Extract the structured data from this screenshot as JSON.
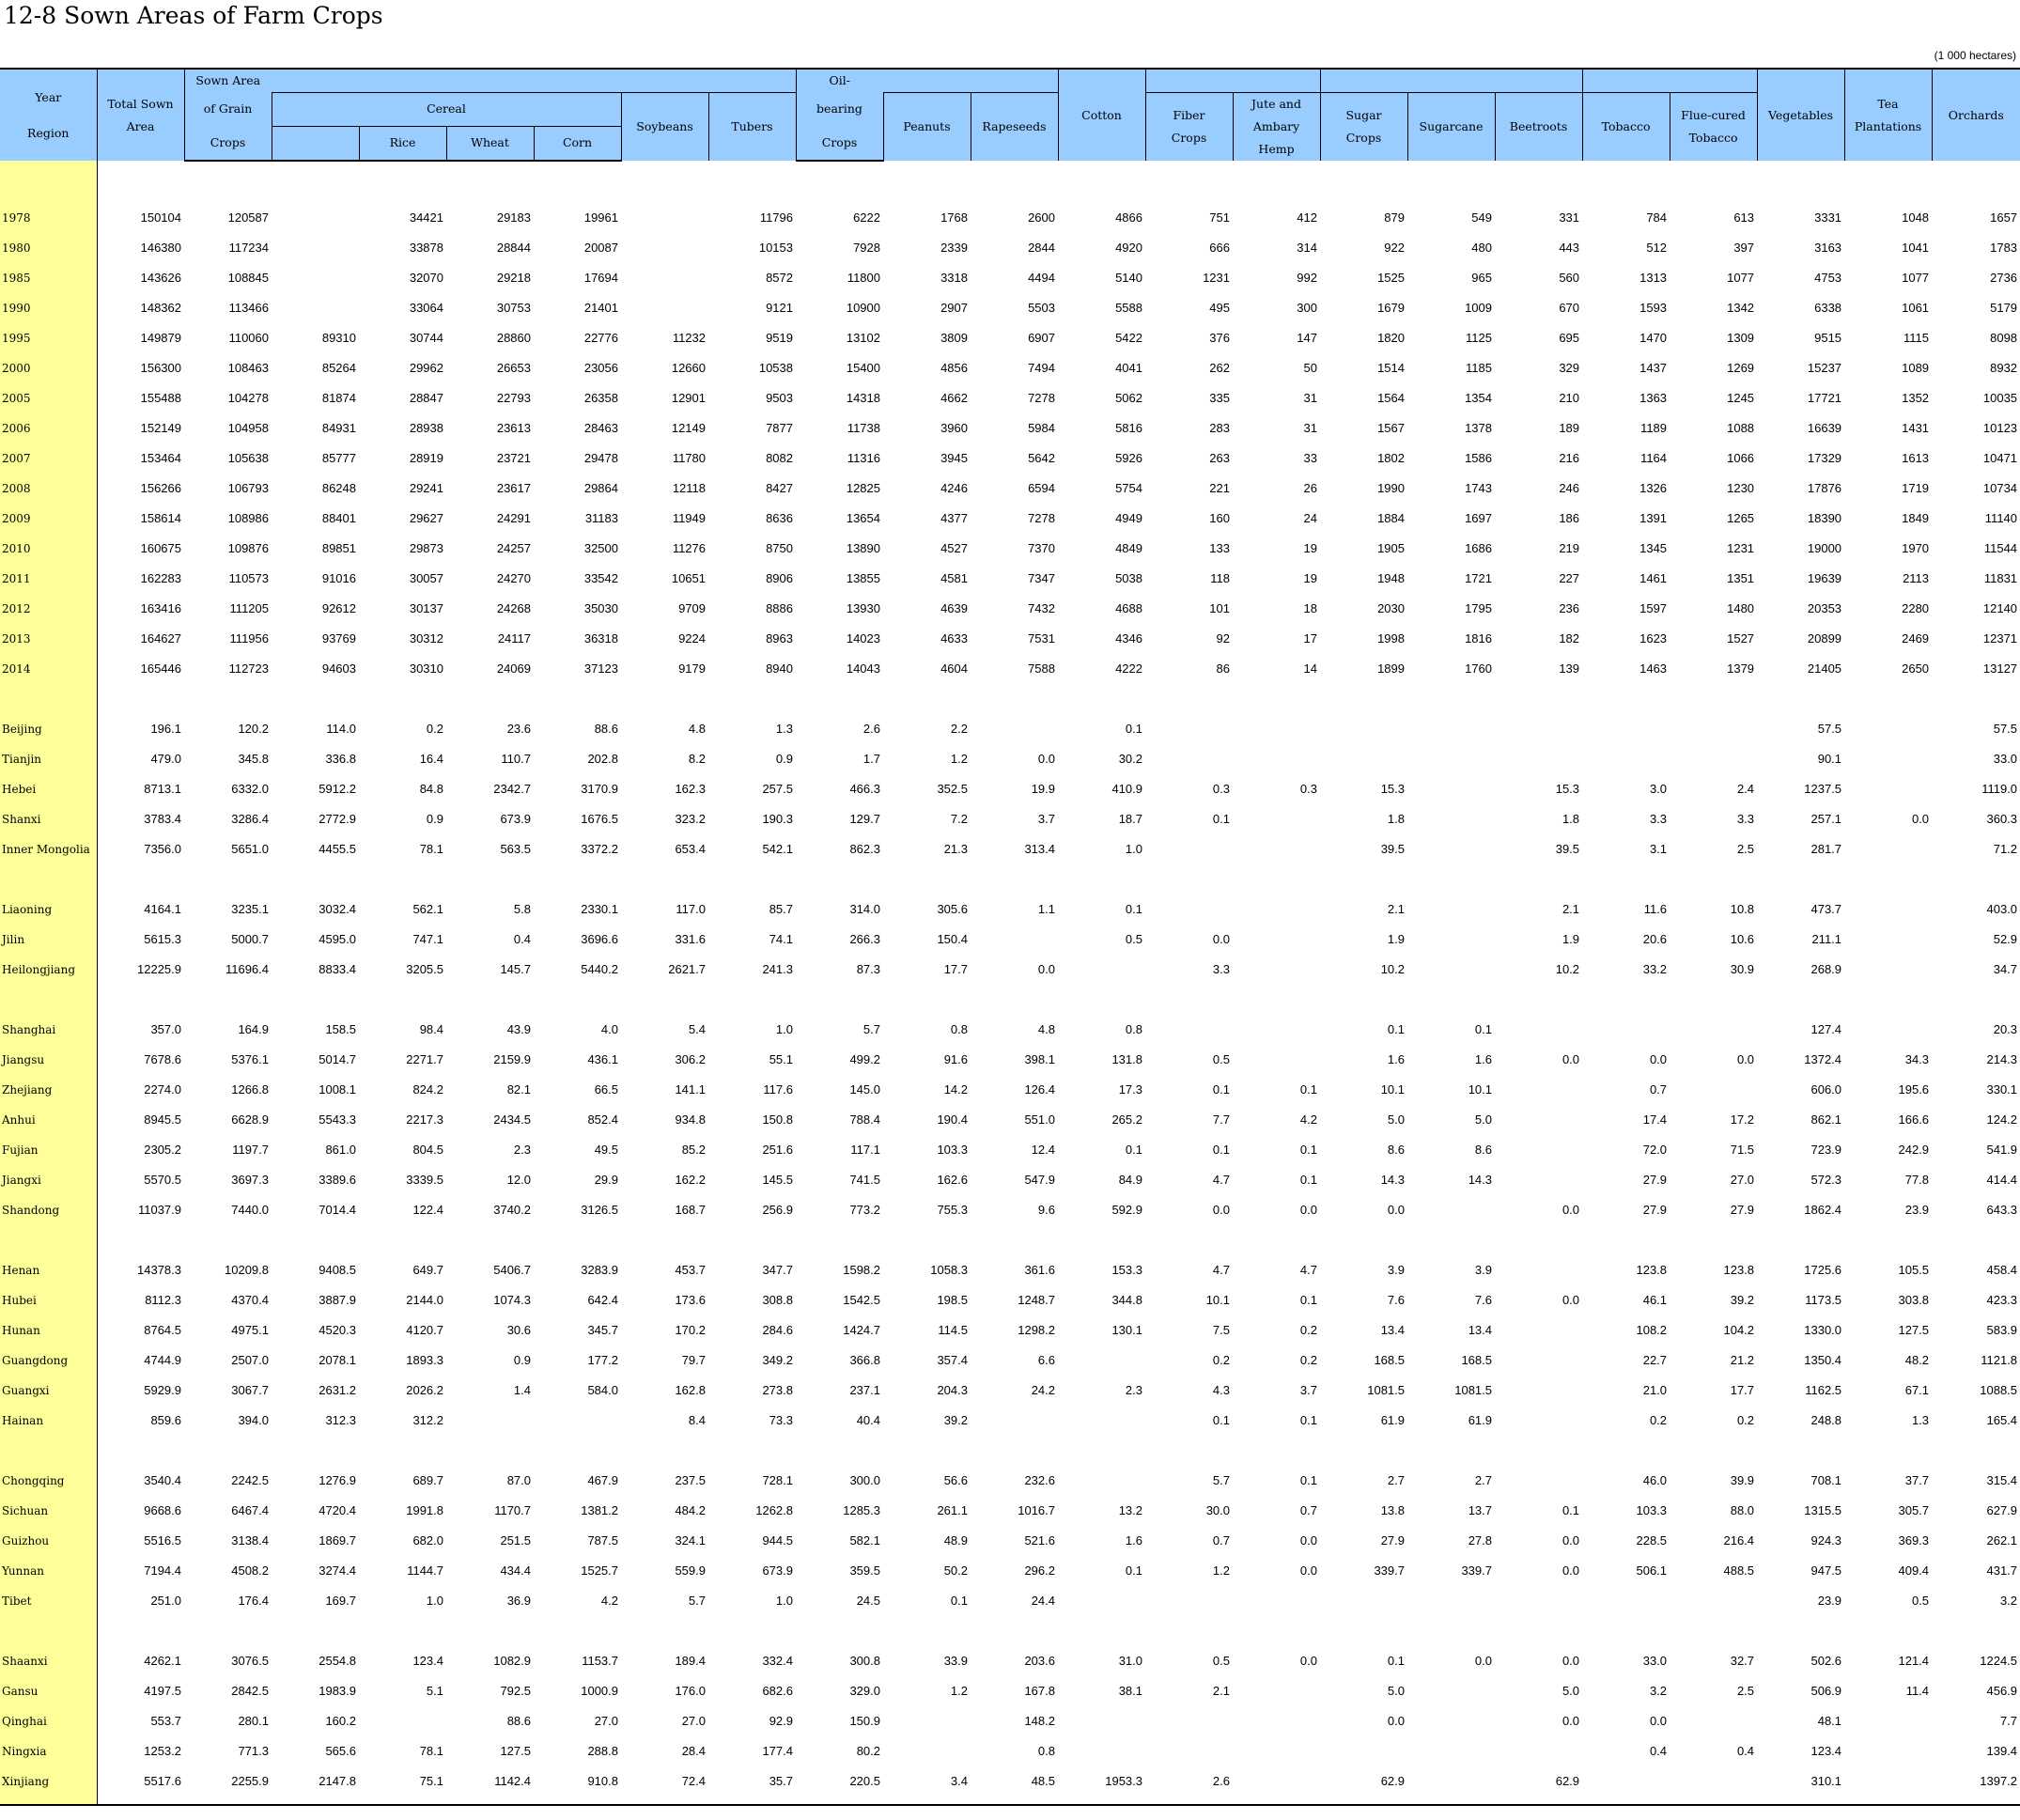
{
  "title": "12-8  Sown Areas of Farm Crops",
  "unit_note": "(1 000 hectares)",
  "header": {
    "year": "Year",
    "region": "Region",
    "total_sown_1": "Total Sown",
    "total_sown_2": "Area",
    "grain_1": "Sown Area",
    "grain_2": "of Grain",
    "grain_3": "Crops",
    "cereal": "Cereal",
    "rice": "Rice",
    "wheat": "Wheat",
    "corn": "Corn",
    "soybeans": "Soybeans",
    "tubers": "Tubers",
    "oil_1": "Oil-",
    "oil_2": "bearing",
    "oil_3": "Crops",
    "peanuts": "Peanuts",
    "rapeseeds": "Rapeseeds",
    "cotton": "Cotton",
    "fiber_1": "Fiber",
    "fiber_2": "Crops",
    "jute_1": "Jute and",
    "jute_2": "Ambary Hemp",
    "sugar_1": "Sugar",
    "sugar_2": "Crops",
    "sugarcane": "Sugarcane",
    "beetroots": "Beetroots",
    "tobacco": "Tobacco",
    "flue_1": "Flue-cured",
    "flue_2": "Tobacco",
    "vegetables": "Vegetables",
    "tea_1": "Tea",
    "tea_2": "Plantations",
    "orchards": "Orchards"
  },
  "row_groups": [
    [
      [
        "1978",
        "150104",
        "120587",
        "",
        "34421",
        "29183",
        "19961",
        "",
        "11796",
        "6222",
        "1768",
        "2600",
        "4866",
        "751",
        "412",
        "879",
        "549",
        "331",
        "784",
        "613",
        "3331",
        "1048",
        "1657"
      ],
      [
        "1980",
        "146380",
        "117234",
        "",
        "33878",
        "28844",
        "20087",
        "",
        "10153",
        "7928",
        "2339",
        "2844",
        "4920",
        "666",
        "314",
        "922",
        "480",
        "443",
        "512",
        "397",
        "3163",
        "1041",
        "1783"
      ],
      [
        "1985",
        "143626",
        "108845",
        "",
        "32070",
        "29218",
        "17694",
        "",
        "8572",
        "11800",
        "3318",
        "4494",
        "5140",
        "1231",
        "992",
        "1525",
        "965",
        "560",
        "1313",
        "1077",
        "4753",
        "1077",
        "2736"
      ],
      [
        "1990",
        "148362",
        "113466",
        "",
        "33064",
        "30753",
        "21401",
        "",
        "9121",
        "10900",
        "2907",
        "5503",
        "5588",
        "495",
        "300",
        "1679",
        "1009",
        "670",
        "1593",
        "1342",
        "6338",
        "1061",
        "5179"
      ],
      [
        "1995",
        "149879",
        "110060",
        "89310",
        "30744",
        "28860",
        "22776",
        "11232",
        "9519",
        "13102",
        "3809",
        "6907",
        "5422",
        "376",
        "147",
        "1820",
        "1125",
        "695",
        "1470",
        "1309",
        "9515",
        "1115",
        "8098"
      ],
      [
        "2000",
        "156300",
        "108463",
        "85264",
        "29962",
        "26653",
        "23056",
        "12660",
        "10538",
        "15400",
        "4856",
        "7494",
        "4041",
        "262",
        "50",
        "1514",
        "1185",
        "329",
        "1437",
        "1269",
        "15237",
        "1089",
        "8932"
      ],
      [
        "2005",
        "155488",
        "104278",
        "81874",
        "28847",
        "22793",
        "26358",
        "12901",
        "9503",
        "14318",
        "4662",
        "7278",
        "5062",
        "335",
        "31",
        "1564",
        "1354",
        "210",
        "1363",
        "1245",
        "17721",
        "1352",
        "10035"
      ],
      [
        "2006",
        "152149",
        "104958",
        "84931",
        "28938",
        "23613",
        "28463",
        "12149",
        "7877",
        "11738",
        "3960",
        "5984",
        "5816",
        "283",
        "31",
        "1567",
        "1378",
        "189",
        "1189",
        "1088",
        "16639",
        "1431",
        "10123"
      ],
      [
        "2007",
        "153464",
        "105638",
        "85777",
        "28919",
        "23721",
        "29478",
        "11780",
        "8082",
        "11316",
        "3945",
        "5642",
        "5926",
        "263",
        "33",
        "1802",
        "1586",
        "216",
        "1164",
        "1066",
        "17329",
        "1613",
        "10471"
      ],
      [
        "2008",
        "156266",
        "106793",
        "86248",
        "29241",
        "23617",
        "29864",
        "12118",
        "8427",
        "12825",
        "4246",
        "6594",
        "5754",
        "221",
        "26",
        "1990",
        "1743",
        "246",
        "1326",
        "1230",
        "17876",
        "1719",
        "10734"
      ],
      [
        "2009",
        "158614",
        "108986",
        "88401",
        "29627",
        "24291",
        "31183",
        "11949",
        "8636",
        "13654",
        "4377",
        "7278",
        "4949",
        "160",
        "24",
        "1884",
        "1697",
        "186",
        "1391",
        "1265",
        "18390",
        "1849",
        "11140"
      ],
      [
        "2010",
        "160675",
        "109876",
        "89851",
        "29873",
        "24257",
        "32500",
        "11276",
        "8750",
        "13890",
        "4527",
        "7370",
        "4849",
        "133",
        "19",
        "1905",
        "1686",
        "219",
        "1345",
        "1231",
        "19000",
        "1970",
        "11544"
      ],
      [
        "2011",
        "162283",
        "110573",
        "91016",
        "30057",
        "24270",
        "33542",
        "10651",
        "8906",
        "13855",
        "4581",
        "7347",
        "5038",
        "118",
        "19",
        "1948",
        "1721",
        "227",
        "1461",
        "1351",
        "19639",
        "2113",
        "11831"
      ],
      [
        "2012",
        "163416",
        "111205",
        "92612",
        "30137",
        "24268",
        "35030",
        "9709",
        "8886",
        "13930",
        "4639",
        "7432",
        "4688",
        "101",
        "18",
        "2030",
        "1795",
        "236",
        "1597",
        "1480",
        "20353",
        "2280",
        "12140"
      ],
      [
        "2013",
        "164627",
        "111956",
        "93769",
        "30312",
        "24117",
        "36318",
        "9224",
        "8963",
        "14023",
        "4633",
        "7531",
        "4346",
        "92",
        "17",
        "1998",
        "1816",
        "182",
        "1623",
        "1527",
        "20899",
        "2469",
        "12371"
      ],
      [
        "2014",
        "165446",
        "112723",
        "94603",
        "30310",
        "24069",
        "37123",
        "9179",
        "8940",
        "14043",
        "4604",
        "7588",
        "4222",
        "86",
        "14",
        "1899",
        "1760",
        "139",
        "1463",
        "1379",
        "21405",
        "2650",
        "13127"
      ]
    ],
    [
      [
        "Beijing",
        "196.1",
        "120.2",
        "114.0",
        "0.2",
        "23.6",
        "88.6",
        "4.8",
        "1.3",
        "2.6",
        "2.2",
        "",
        "0.1",
        "",
        "",
        "",
        "",
        "",
        "",
        "",
        "57.5",
        "",
        "57.5"
      ],
      [
        "Tianjin",
        "479.0",
        "345.8",
        "336.8",
        "16.4",
        "110.7",
        "202.8",
        "8.2",
        "0.9",
        "1.7",
        "1.2",
        "0.0",
        "30.2",
        "",
        "",
        "",
        "",
        "",
        "",
        "",
        "90.1",
        "",
        "33.0"
      ],
      [
        "Hebei",
        "8713.1",
        "6332.0",
        "5912.2",
        "84.8",
        "2342.7",
        "3170.9",
        "162.3",
        "257.5",
        "466.3",
        "352.5",
        "19.9",
        "410.9",
        "0.3",
        "0.3",
        "15.3",
        "",
        "15.3",
        "3.0",
        "2.4",
        "1237.5",
        "",
        "1119.0"
      ],
      [
        "Shanxi",
        "3783.4",
        "3286.4",
        "2772.9",
        "0.9",
        "673.9",
        "1676.5",
        "323.2",
        "190.3",
        "129.7",
        "7.2",
        "3.7",
        "18.7",
        "0.1",
        "",
        "1.8",
        "",
        "1.8",
        "3.3",
        "3.3",
        "257.1",
        "0.0",
        "360.3"
      ],
      [
        "Inner Mongolia",
        "7356.0",
        "5651.0",
        "4455.5",
        "78.1",
        "563.5",
        "3372.2",
        "653.4",
        "542.1",
        "862.3",
        "21.3",
        "313.4",
        "1.0",
        "",
        "",
        "39.5",
        "",
        "39.5",
        "3.1",
        "2.5",
        "281.7",
        "",
        "71.2"
      ]
    ],
    [
      [
        "Liaoning",
        "4164.1",
        "3235.1",
        "3032.4",
        "562.1",
        "5.8",
        "2330.1",
        "117.0",
        "85.7",
        "314.0",
        "305.6",
        "1.1",
        "0.1",
        "",
        "",
        "2.1",
        "",
        "2.1",
        "11.6",
        "10.8",
        "473.7",
        "",
        "403.0"
      ],
      [
        "Jilin",
        "5615.3",
        "5000.7",
        "4595.0",
        "747.1",
        "0.4",
        "3696.6",
        "331.6",
        "74.1",
        "266.3",
        "150.4",
        "",
        "0.5",
        "0.0",
        "",
        "1.9",
        "",
        "1.9",
        "20.6",
        "10.6",
        "211.1",
        "",
        "52.9"
      ],
      [
        "Heilongjiang",
        "12225.9",
        "11696.4",
        "8833.4",
        "3205.5",
        "145.7",
        "5440.2",
        "2621.7",
        "241.3",
        "87.3",
        "17.7",
        "0.0",
        "",
        "3.3",
        "",
        "10.2",
        "",
        "10.2",
        "33.2",
        "30.9",
        "268.9",
        "",
        "34.7"
      ]
    ],
    [
      [
        "Shanghai",
        "357.0",
        "164.9",
        "158.5",
        "98.4",
        "43.9",
        "4.0",
        "5.4",
        "1.0",
        "5.7",
        "0.8",
        "4.8",
        "0.8",
        "",
        "",
        "0.1",
        "0.1",
        "",
        "",
        "",
        "127.4",
        "",
        "20.3"
      ],
      [
        "Jiangsu",
        "7678.6",
        "5376.1",
        "5014.7",
        "2271.7",
        "2159.9",
        "436.1",
        "306.2",
        "55.1",
        "499.2",
        "91.6",
        "398.1",
        "131.8",
        "0.5",
        "",
        "1.6",
        "1.6",
        "0.0",
        "0.0",
        "0.0",
        "1372.4",
        "34.3",
        "214.3"
      ],
      [
        "Zhejiang",
        "2274.0",
        "1266.8",
        "1008.1",
        "824.2",
        "82.1",
        "66.5",
        "141.1",
        "117.6",
        "145.0",
        "14.2",
        "126.4",
        "17.3",
        "0.1",
        "0.1",
        "10.1",
        "10.1",
        "",
        "0.7",
        "",
        "606.0",
        "195.6",
        "330.1"
      ],
      [
        "Anhui",
        "8945.5",
        "6628.9",
        "5543.3",
        "2217.3",
        "2434.5",
        "852.4",
        "934.8",
        "150.8",
        "788.4",
        "190.4",
        "551.0",
        "265.2",
        "7.7",
        "4.2",
        "5.0",
        "5.0",
        "",
        "17.4",
        "17.2",
        "862.1",
        "166.6",
        "124.2"
      ],
      [
        "Fujian",
        "2305.2",
        "1197.7",
        "861.0",
        "804.5",
        "2.3",
        "49.5",
        "85.2",
        "251.6",
        "117.1",
        "103.3",
        "12.4",
        "0.1",
        "0.1",
        "0.1",
        "8.6",
        "8.6",
        "",
        "72.0",
        "71.5",
        "723.9",
        "242.9",
        "541.9"
      ],
      [
        "Jiangxi",
        "5570.5",
        "3697.3",
        "3389.6",
        "3339.5",
        "12.0",
        "29.9",
        "162.2",
        "145.5",
        "741.5",
        "162.6",
        "547.9",
        "84.9",
        "4.7",
        "0.1",
        "14.3",
        "14.3",
        "",
        "27.9",
        "27.0",
        "572.3",
        "77.8",
        "414.4"
      ],
      [
        "Shandong",
        "11037.9",
        "7440.0",
        "7014.4",
        "122.4",
        "3740.2",
        "3126.5",
        "168.7",
        "256.9",
        "773.2",
        "755.3",
        "9.6",
        "592.9",
        "0.0",
        "0.0",
        "0.0",
        "",
        "0.0",
        "27.9",
        "27.9",
        "1862.4",
        "23.9",
        "643.3"
      ]
    ],
    [
      [
        "Henan",
        "14378.3",
        "10209.8",
        "9408.5",
        "649.7",
        "5406.7",
        "3283.9",
        "453.7",
        "347.7",
        "1598.2",
        "1058.3",
        "361.6",
        "153.3",
        "4.7",
        "4.7",
        "3.9",
        "3.9",
        "",
        "123.8",
        "123.8",
        "1725.6",
        "105.5",
        "458.4"
      ],
      [
        "Hubei",
        "8112.3",
        "4370.4",
        "3887.9",
        "2144.0",
        "1074.3",
        "642.4",
        "173.6",
        "308.8",
        "1542.5",
        "198.5",
        "1248.7",
        "344.8",
        "10.1",
        "0.1",
        "7.6",
        "7.6",
        "0.0",
        "46.1",
        "39.2",
        "1173.5",
        "303.8",
        "423.3"
      ],
      [
        "Hunan",
        "8764.5",
        "4975.1",
        "4520.3",
        "4120.7",
        "30.6",
        "345.7",
        "170.2",
        "284.6",
        "1424.7",
        "114.5",
        "1298.2",
        "130.1",
        "7.5",
        "0.2",
        "13.4",
        "13.4",
        "",
        "108.2",
        "104.2",
        "1330.0",
        "127.5",
        "583.9"
      ],
      [
        "Guangdong",
        "4744.9",
        "2507.0",
        "2078.1",
        "1893.3",
        "0.9",
        "177.2",
        "79.7",
        "349.2",
        "366.8",
        "357.4",
        "6.6",
        "",
        "0.2",
        "0.2",
        "168.5",
        "168.5",
        "",
        "22.7",
        "21.2",
        "1350.4",
        "48.2",
        "1121.8"
      ],
      [
        "Guangxi",
        "5929.9",
        "3067.7",
        "2631.2",
        "2026.2",
        "1.4",
        "584.0",
        "162.8",
        "273.8",
        "237.1",
        "204.3",
        "24.2",
        "2.3",
        "4.3",
        "3.7",
        "1081.5",
        "1081.5",
        "",
        "21.0",
        "17.7",
        "1162.5",
        "67.1",
        "1088.5"
      ],
      [
        "Hainan",
        "859.6",
        "394.0",
        "312.3",
        "312.2",
        "",
        "",
        "8.4",
        "73.3",
        "40.4",
        "39.2",
        "",
        "",
        "0.1",
        "0.1",
        "61.9",
        "61.9",
        "",
        "0.2",
        "0.2",
        "248.8",
        "1.3",
        "165.4"
      ]
    ],
    [
      [
        "Chongqing",
        "3540.4",
        "2242.5",
        "1276.9",
        "689.7",
        "87.0",
        "467.9",
        "237.5",
        "728.1",
        "300.0",
        "56.6",
        "232.6",
        "",
        "5.7",
        "0.1",
        "2.7",
        "2.7",
        "",
        "46.0",
        "39.9",
        "708.1",
        "37.7",
        "315.4"
      ],
      [
        "Sichuan",
        "9668.6",
        "6467.4",
        "4720.4",
        "1991.8",
        "1170.7",
        "1381.2",
        "484.2",
        "1262.8",
        "1285.3",
        "261.1",
        "1016.7",
        "13.2",
        "30.0",
        "0.7",
        "13.8",
        "13.7",
        "0.1",
        "103.3",
        "88.0",
        "1315.5",
        "305.7",
        "627.9"
      ],
      [
        "Guizhou",
        "5516.5",
        "3138.4",
        "1869.7",
        "682.0",
        "251.5",
        "787.5",
        "324.1",
        "944.5",
        "582.1",
        "48.9",
        "521.6",
        "1.6",
        "0.7",
        "0.0",
        "27.9",
        "27.8",
        "0.0",
        "228.5",
        "216.4",
        "924.3",
        "369.3",
        "262.1"
      ],
      [
        "Yunnan",
        "7194.4",
        "4508.2",
        "3274.4",
        "1144.7",
        "434.4",
        "1525.7",
        "559.9",
        "673.9",
        "359.5",
        "50.2",
        "296.2",
        "0.1",
        "1.2",
        "0.0",
        "339.7",
        "339.7",
        "0.0",
        "506.1",
        "488.5",
        "947.5",
        "409.4",
        "431.7"
      ],
      [
        "Tibet",
        "251.0",
        "176.4",
        "169.7",
        "1.0",
        "36.9",
        "4.2",
        "5.7",
        "1.0",
        "24.5",
        "0.1",
        "24.4",
        "",
        "",
        "",
        "",
        "",
        "",
        "",
        "",
        "23.9",
        "0.5",
        "3.2"
      ]
    ],
    [
      [
        "Shaanxi",
        "4262.1",
        "3076.5",
        "2554.8",
        "123.4",
        "1082.9",
        "1153.7",
        "189.4",
        "332.4",
        "300.8",
        "33.9",
        "203.6",
        "31.0",
        "0.5",
        "0.0",
        "0.1",
        "0.0",
        "0.0",
        "33.0",
        "32.7",
        "502.6",
        "121.4",
        "1224.5"
      ],
      [
        "Gansu",
        "4197.5",
        "2842.5",
        "1983.9",
        "5.1",
        "792.5",
        "1000.9",
        "176.0",
        "682.6",
        "329.0",
        "1.2",
        "167.8",
        "38.1",
        "2.1",
        "",
        "5.0",
        "",
        "5.0",
        "3.2",
        "2.5",
        "506.9",
        "11.4",
        "456.9"
      ],
      [
        "Qinghai",
        "553.7",
        "280.1",
        "160.2",
        "",
        "88.6",
        "27.0",
        "27.0",
        "92.9",
        "150.9",
        "",
        "148.2",
        "",
        "",
        "",
        "0.0",
        "",
        "0.0",
        "0.0",
        "",
        "48.1",
        "",
        "7.7"
      ],
      [
        "Ningxia",
        "1253.2",
        "771.3",
        "565.6",
        "78.1",
        "127.5",
        "288.8",
        "28.4",
        "177.4",
        "80.2",
        "",
        "0.8",
        "",
        "",
        "",
        "",
        "",
        "",
        "0.4",
        "0.4",
        "123.4",
        "",
        "139.4"
      ],
      [
        "Xinjiang",
        "5517.6",
        "2255.9",
        "2147.8",
        "75.1",
        "1142.4",
        "910.8",
        "72.4",
        "35.7",
        "220.5",
        "3.4",
        "48.5",
        "1953.3",
        "2.6",
        "",
        "62.9",
        "",
        "62.9",
        "",
        "",
        "310.1",
        "",
        "1397.2"
      ]
    ]
  ]
}
